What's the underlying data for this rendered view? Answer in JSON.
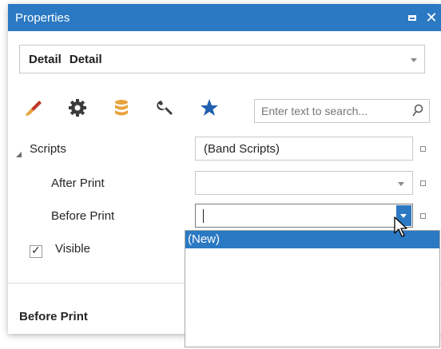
{
  "window": {
    "title": "Properties",
    "maximize_icon": "maximize-icon",
    "close_glyph": "✕"
  },
  "object_selector": {
    "name": "Detail",
    "type": "Detail"
  },
  "tabs": [
    {
      "icon": "brush-icon",
      "color": "#c0392b"
    },
    {
      "icon": "gear-icon",
      "color": "#3c3c3c"
    },
    {
      "icon": "database-icon",
      "color": "#e8a33d"
    },
    {
      "icon": "wrench-icon",
      "color": "#3c3c3c"
    },
    {
      "icon": "star-icon",
      "color": "#1f5fae"
    }
  ],
  "search": {
    "placeholder": "Enter text to search..."
  },
  "properties": {
    "scripts": {
      "label": "Scripts",
      "value": "(Band Scripts)"
    },
    "after_print": {
      "label": "After Print",
      "value": ""
    },
    "before_print": {
      "label": "Before Print",
      "value": ""
    },
    "visible": {
      "label": "Visible",
      "checked": true,
      "check_glyph": "✓"
    }
  },
  "description": {
    "title": "Before Print"
  },
  "dropdown": {
    "items": [
      "(New)"
    ],
    "selected_index": 0
  },
  "colors": {
    "accent": "#2b79c2"
  }
}
